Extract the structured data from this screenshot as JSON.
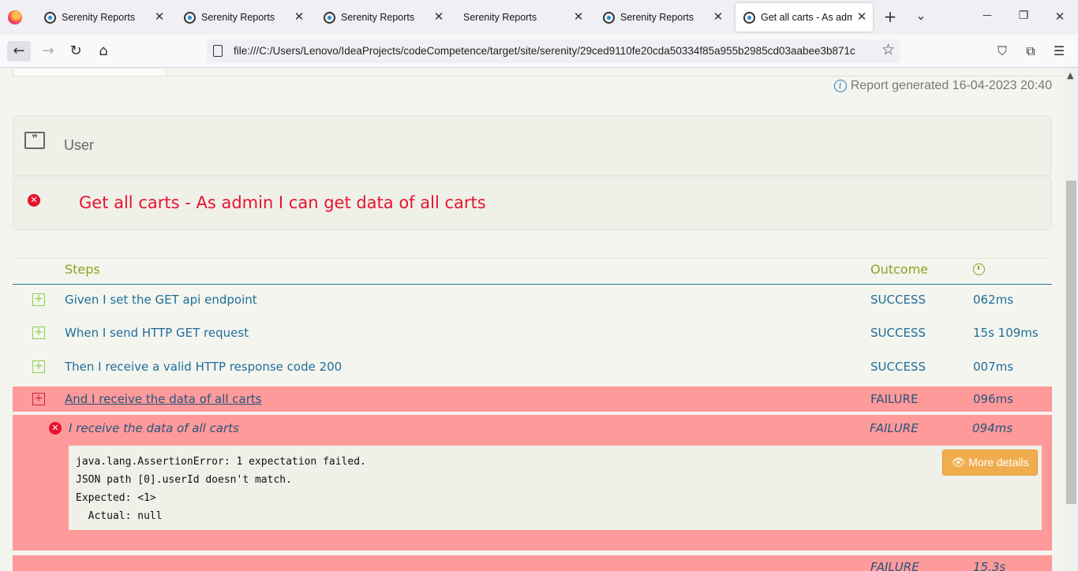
{
  "browser": {
    "tabs": [
      {
        "label": "Serenity Reports",
        "close": "✕"
      },
      {
        "label": "Serenity Reports",
        "close": "✕"
      },
      {
        "label": "Serenity Reports",
        "close": "✕"
      },
      {
        "label": "Serenity Reports",
        "close": "✕"
      },
      {
        "label": "Serenity Reports",
        "close": "✕"
      },
      {
        "label": "Get all carts - As admin",
        "close": "✕"
      }
    ],
    "new_tab": "+",
    "tab_list": "⌄",
    "window": {
      "minimize": "—",
      "restore": "❐",
      "close": "✕"
    },
    "nav": {
      "back": "←",
      "forward": "→",
      "reload": "↻",
      "home": "⌂"
    },
    "url": "file:///C:/Users/Lenovo/IdeaProjects/codeCompetence/target/site/serenity/29ced9110fe20cda50334f85a955b2985cd03aabee3b871c",
    "bookmark": "☆",
    "toolbar": {
      "pocket": "⛉",
      "extensions": "⧉",
      "menu": "☰"
    }
  },
  "report": {
    "generated": "Report generated 16-04-2023 20:40",
    "info_glyph": "i",
    "user_label": "User",
    "quote_glyph": "❞",
    "scenario_title": "Get all carts - As admin I can get data of all carts",
    "x_glyph": "✕"
  },
  "steps": {
    "headers": {
      "steps": "Steps",
      "outcome": "Outcome"
    },
    "rows": [
      {
        "toggle": "+",
        "description": "Given I set the GET api endpoint",
        "outcome": "SUCCESS",
        "duration": "062ms"
      },
      {
        "toggle": "+",
        "description": "When I send HTTP GET request",
        "outcome": "SUCCESS",
        "duration": "15s 109ms"
      },
      {
        "toggle": "+",
        "description": "Then I receive a valid HTTP response code 200",
        "outcome": "SUCCESS",
        "duration": "007ms"
      },
      {
        "toggle": "+",
        "description": "And I receive the data of all carts",
        "outcome": "FAILURE",
        "duration": "096ms"
      }
    ],
    "sub_step": {
      "description": "I receive the data of all carts",
      "outcome": "FAILURE",
      "duration": "094ms"
    },
    "error_text": "java.lang.AssertionError: 1 expectation failed.\nJSON path [0].userId doesn't match.\nExpected: <1>\n  Actual: null",
    "more_details": "👁 More details",
    "next_row": {
      "outcome": "FAILURE",
      "duration": "15.3s"
    }
  },
  "colors": {
    "success_text": "#1e6e98",
    "failure_row": "#fe9a9a",
    "error_red": "#e8122e",
    "header_green": "#8ca31e",
    "button_orange": "#f0ad4e"
  }
}
